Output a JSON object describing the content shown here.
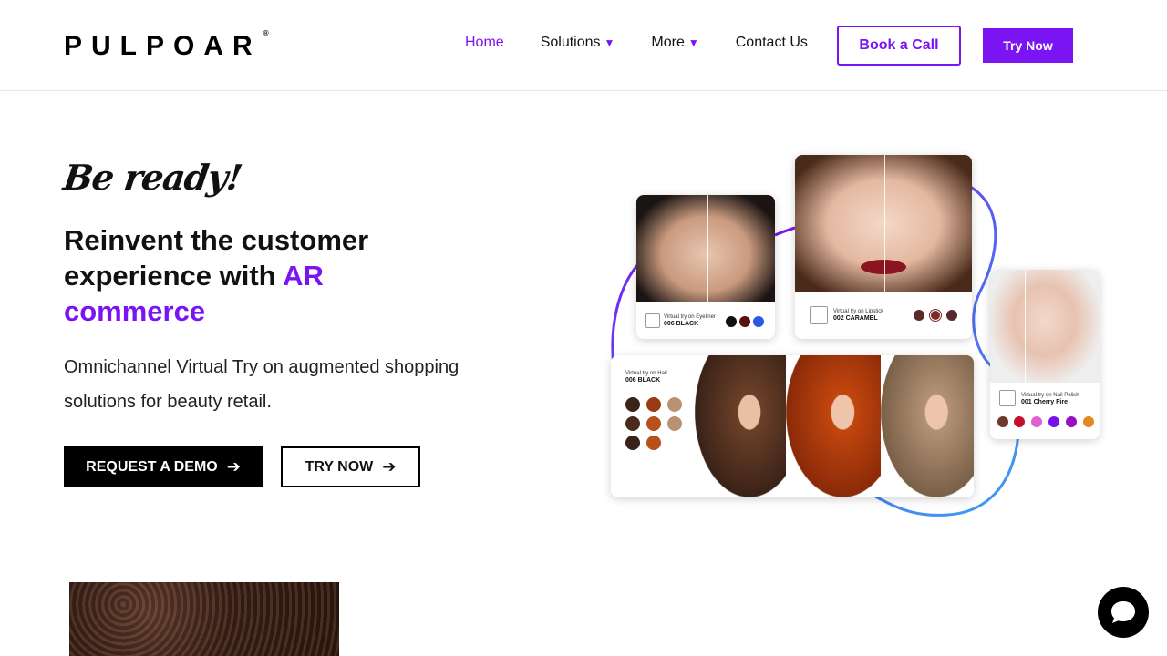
{
  "header": {
    "logo_text": "PULPOAR",
    "logo_mark": "®",
    "nav": [
      {
        "label": "Home",
        "active": true,
        "has_dropdown": false
      },
      {
        "label": "Solutions",
        "active": false,
        "has_dropdown": true
      },
      {
        "label": "More",
        "active": false,
        "has_dropdown": true
      },
      {
        "label": "Contact Us",
        "active": false,
        "has_dropdown": false
      }
    ],
    "book_call_label": "Book a Call",
    "try_now_label": "Try Now"
  },
  "hero": {
    "tagline": "Be ready!",
    "headline_part1": "Reinvent the customer experience with ",
    "headline_accent": "AR commerce",
    "subtext": "Omnichannel Virtual Try on augmented shopping solutions for beauty retail.",
    "demo_label": "REQUEST A DEMO",
    "try_label": "TRY NOW"
  },
  "collage": {
    "eyeliner": {
      "caption": "Virtual try on Eyeliner",
      "shade": "006 BLACK",
      "swatches": [
        "#111111",
        "#5a0f0f",
        "#2b56e8"
      ]
    },
    "lipstick": {
      "caption": "Virtual try on Lipstick",
      "shade": "002 CARAMEL",
      "swatches": [
        "#5a2a24",
        "#7a2a2a",
        "#5a2630"
      ]
    },
    "hair": {
      "caption": "Virtual try on Hair",
      "shade": "006 BLACK",
      "swatches": [
        "#3a2419",
        "#9a3a12",
        "#b89272",
        "#4a2a1a",
        "#b8501a",
        "#b89272",
        "#3a2219",
        "#b8501a"
      ]
    },
    "nail": {
      "caption": "Virtual try on Nail Polish",
      "shade": "001 Cherry Fire",
      "swatches": [
        "#6b3a2a",
        "#c4102a",
        "#e060d0",
        "#7a10f0",
        "#9a10c0",
        "#e08a20"
      ]
    }
  },
  "colors": {
    "accent": "#7b14f2",
    "text": "#111111"
  },
  "icons": {
    "dropdown": "caret-down-icon",
    "arrow": "arrow-right-icon",
    "chat": "chat-bubble-icon"
  }
}
